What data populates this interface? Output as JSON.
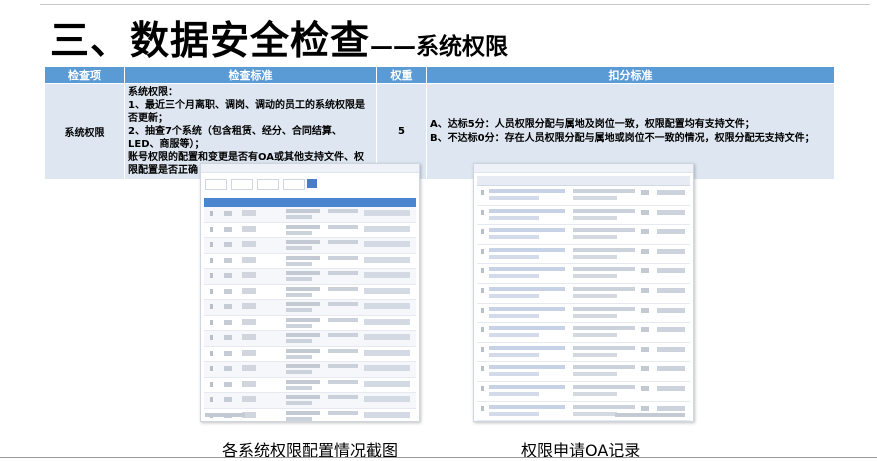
{
  "title": {
    "main": "三、数据安全检查",
    "sub": "——系统权限"
  },
  "table": {
    "headers": [
      "检查项",
      "检查标准",
      "权重",
      "扣分标准"
    ],
    "row": {
      "item": "系统权限",
      "standard_lines": [
        "系统权限：",
        "1、最近三个月离职、调岗、调动的员工的系统权限是否更新；",
        "2、抽查7个系统（包含租赁、经分、合同结算、LED、商服等）；",
        "账号权限的配置和变更是否有OA或其他支持文件、权限配置是否正确"
      ],
      "weight": "5",
      "score_lines": [
        "A、达标5分：人员权限分配与属地及岗位一致，权限配置均有支持文件；",
        "B、不达标0分：存在人员权限分配与属地或岗位不一致的情况，权限分配无支持文件；"
      ]
    }
  },
  "captions": {
    "left": "各系统权限配置情况截图",
    "right": "权限申请OA记录"
  }
}
